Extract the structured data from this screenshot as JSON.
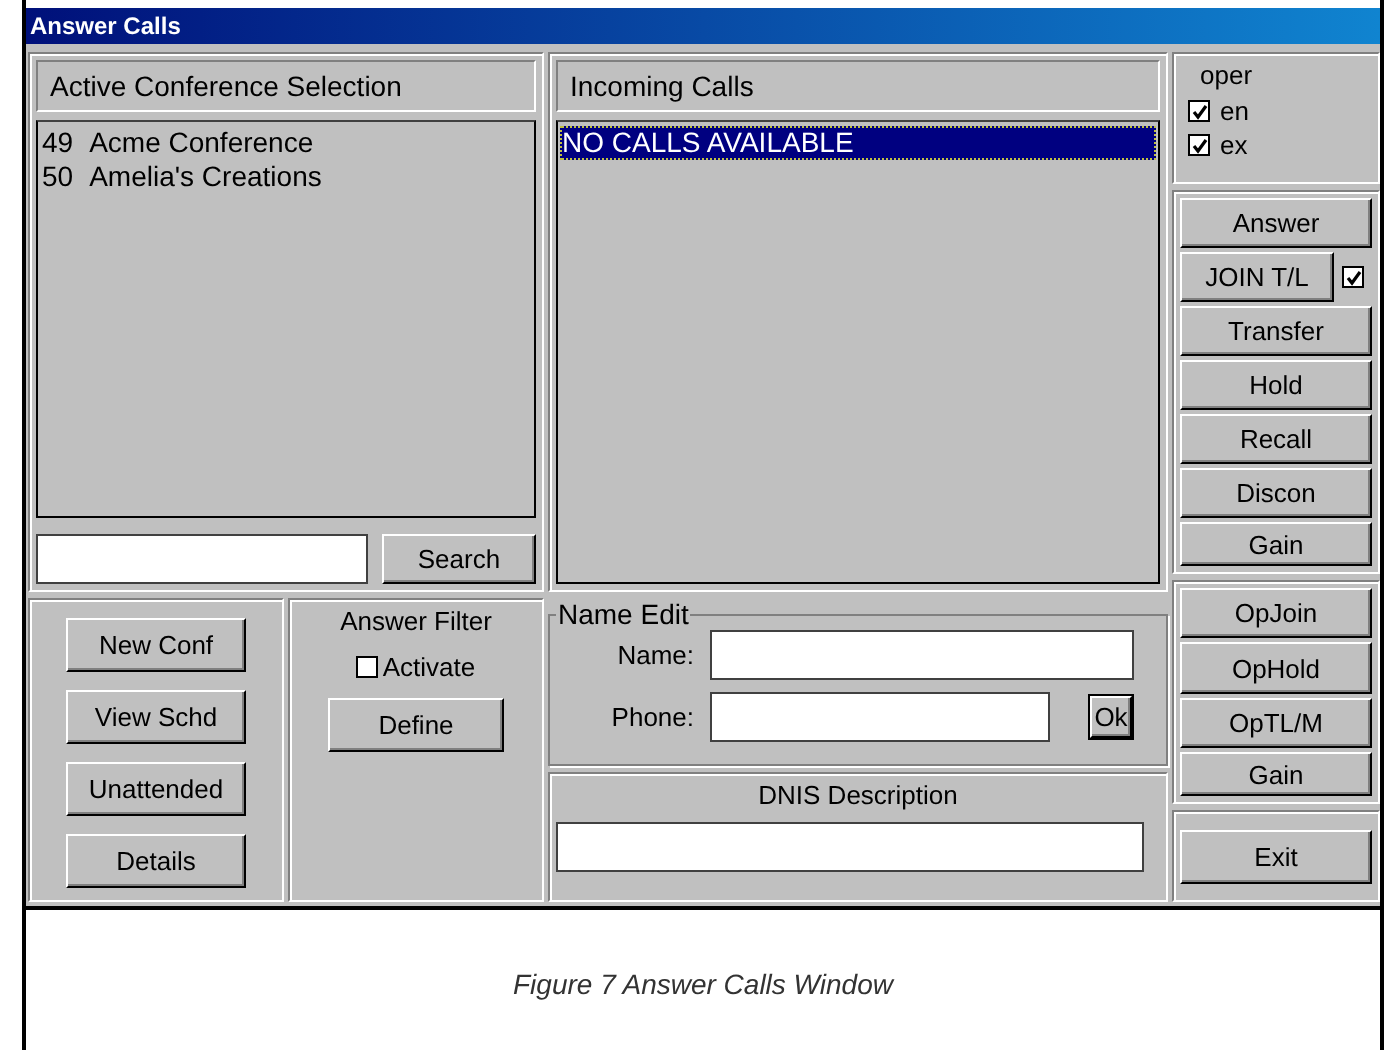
{
  "window": {
    "title": "Answer Calls"
  },
  "conference_panel": {
    "header": "Active Conference Selection",
    "items": [
      {
        "number": "49",
        "name": "Acme Conference",
        "selected": false
      },
      {
        "number": "50",
        "name": "Amelia's Creations",
        "selected": false
      }
    ],
    "search_button": {
      "label": "Search"
    }
  },
  "incoming_panel": {
    "header": "Incoming Calls",
    "items": [
      {
        "text": "NO CALLS AVAILABLE",
        "selected": true
      }
    ]
  },
  "oper": {
    "label": "oper",
    "options": [
      {
        "label": "en",
        "checked": true
      },
      {
        "label": "ex",
        "checked": true
      }
    ]
  },
  "call_buttons": [
    {
      "label": "Answer",
      "kind": "plain"
    },
    {
      "label": "JOIN T/L",
      "kind": "check",
      "checked": true
    },
    {
      "label": "Transfer",
      "kind": "plain"
    },
    {
      "label": "Hold",
      "kind": "plain"
    },
    {
      "label": "Recall",
      "kind": "plain"
    },
    {
      "label": "Discon",
      "kind": "plain"
    },
    {
      "label": "Gain",
      "kind": "plain"
    }
  ],
  "operator_buttons": [
    {
      "label": "OpJoin"
    },
    {
      "label": "OpHold"
    },
    {
      "label": "OpTL/M"
    },
    {
      "label": "Gain"
    }
  ],
  "exit_button": {
    "label": "Exit"
  },
  "conference_buttons": [
    {
      "label": "New Conf"
    },
    {
      "label": "View Schd"
    },
    {
      "label": "Unattended"
    },
    {
      "label": "Details"
    }
  ],
  "answer_filter": {
    "title": "Answer Filter",
    "activate": {
      "label": "Activate",
      "checked": false
    },
    "define_button": {
      "label": "Define"
    }
  },
  "name_edit": {
    "legend": "Name Edit",
    "fields": [
      {
        "label": "Name:",
        "kind": "text"
      },
      {
        "label": "Phone:",
        "kind": "with_ok",
        "ok_button": "Ok"
      }
    ]
  },
  "dnis": {
    "header": "DNIS Description"
  },
  "caption": "Figure 7 Answer Calls Window"
}
